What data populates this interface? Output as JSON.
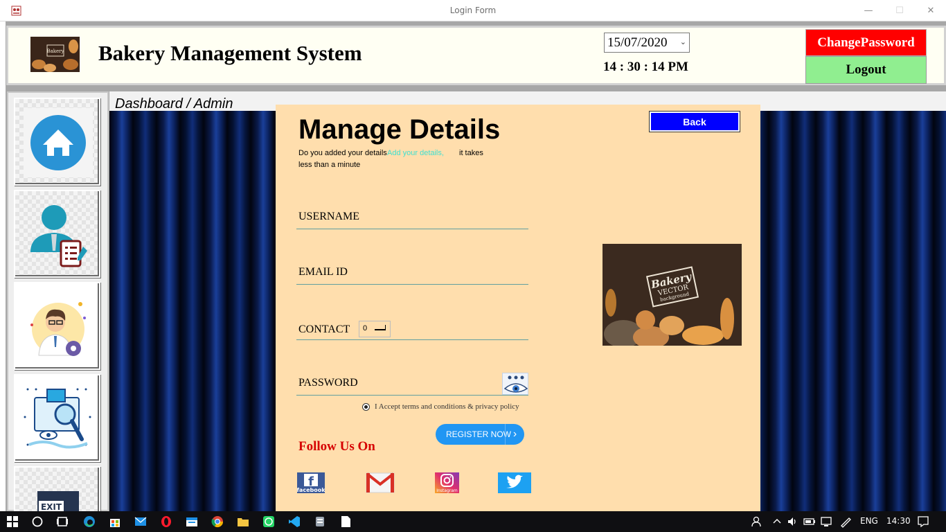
{
  "window": {
    "title": "Login Form",
    "minimize": "—",
    "maximize": "☐",
    "close": "✕"
  },
  "header": {
    "app_title": "Bakery Management System",
    "date": "15/07/2020",
    "time": "14 : 30 : 14 PM",
    "change_password": "ChangePassword",
    "logout": "Logout"
  },
  "breadcrumb": "Dashboard / Admin",
  "sidebar": {
    "items": [
      {
        "name": "home",
        "icon": "home-icon"
      },
      {
        "name": "manage-users",
        "icon": "user-list-icon"
      },
      {
        "name": "settings",
        "icon": "user-gear-icon"
      },
      {
        "name": "view-search",
        "icon": "search-eye-icon"
      },
      {
        "name": "exit",
        "icon": "exit-icon",
        "label": "EXIT"
      }
    ]
  },
  "form": {
    "title": "Manage Details",
    "hint_part1": "Do you added your details",
    "hint_link": "Add your details,",
    "hint_part2": "it takes",
    "hint_part3": "less than a minute",
    "back": "Back",
    "username_label": "USERNAME",
    "email_label": "EMAIL ID",
    "contact_label": "CONTACT",
    "contact_value": "0",
    "password_label": "PASSWORD",
    "terms": "I Accept terms and conditions & privacy policy",
    "register": "REGISTER NOW",
    "register_arrow": "›",
    "follow": "Follow Us On",
    "social": {
      "facebook": "facebook",
      "instagram": "Instagram"
    }
  },
  "promo_image": {
    "line1": "Bakery",
    "line2": "VECTOR",
    "line3": "background"
  },
  "taskbar": {
    "language": "ENG",
    "time": "14:30"
  },
  "colors": {
    "panel": "#ffdead",
    "change_password_bg": "#ff0000",
    "logout_bg": "#90ee90",
    "back_bg": "#0000ff",
    "follow_text": "#d60000",
    "register_bg": "#2196f3"
  }
}
